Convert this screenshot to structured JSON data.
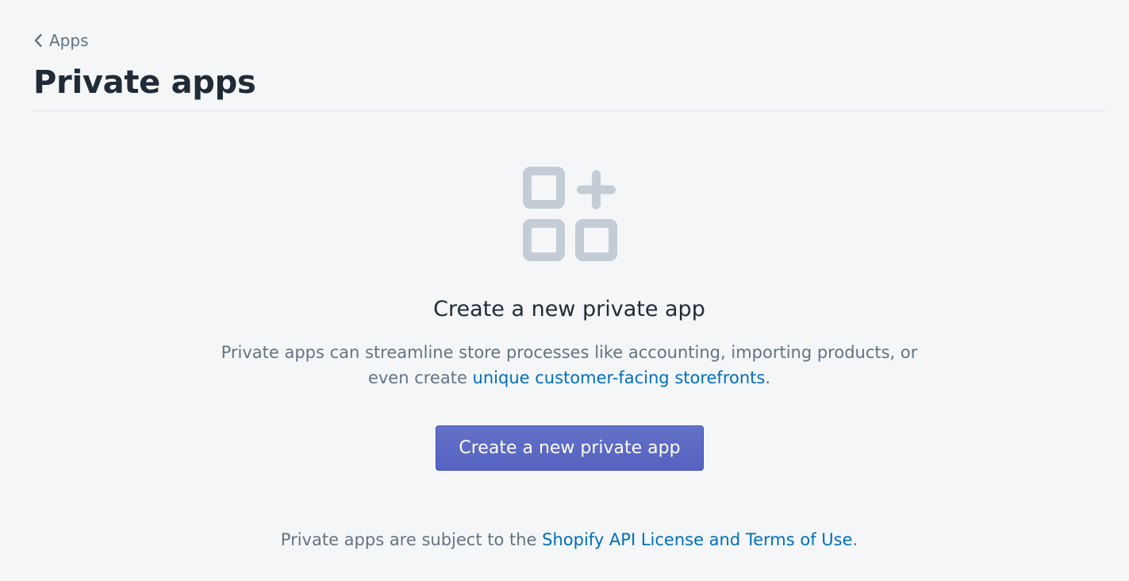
{
  "breadcrumb": {
    "label": "Apps",
    "icon": "chevron-left-icon"
  },
  "page": {
    "title": "Private apps"
  },
  "empty_state": {
    "icon": "apps-add-icon",
    "icon_color": "#c4cdd5",
    "heading": "Create a new private app",
    "description_before": "Private apps can streamline store processes like accounting, importing products, or even create ",
    "description_link": "unique customer-facing storefronts",
    "description_after": ".",
    "button_label": "Create a new private app"
  },
  "footer": {
    "text_before": "Private apps are subject to the ",
    "link": "Shopify API License and Terms of Use",
    "text_after": "."
  },
  "colors": {
    "background": "#f4f6f8",
    "primary": "#5c6ac4",
    "link": "#006fbb",
    "subdued_text": "#637381",
    "heading_text": "#212b36"
  }
}
